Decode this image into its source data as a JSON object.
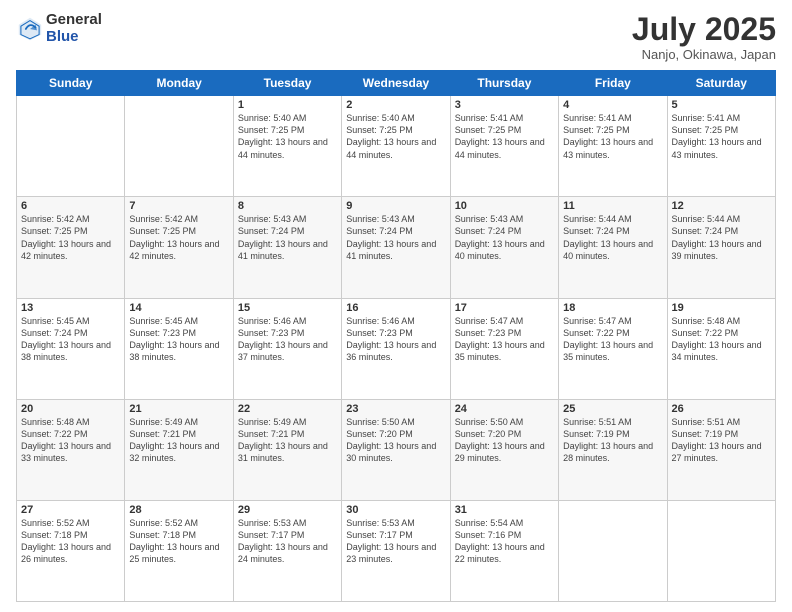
{
  "logo": {
    "general": "General",
    "blue": "Blue"
  },
  "header": {
    "month": "July 2025",
    "location": "Nanjo, Okinawa, Japan"
  },
  "weekdays": [
    "Sunday",
    "Monday",
    "Tuesday",
    "Wednesday",
    "Thursday",
    "Friday",
    "Saturday"
  ],
  "weeks": [
    [
      {
        "day": "",
        "info": ""
      },
      {
        "day": "",
        "info": ""
      },
      {
        "day": "1",
        "info": "Sunrise: 5:40 AM\nSunset: 7:25 PM\nDaylight: 13 hours and 44 minutes."
      },
      {
        "day": "2",
        "info": "Sunrise: 5:40 AM\nSunset: 7:25 PM\nDaylight: 13 hours and 44 minutes."
      },
      {
        "day": "3",
        "info": "Sunrise: 5:41 AM\nSunset: 7:25 PM\nDaylight: 13 hours and 44 minutes."
      },
      {
        "day": "4",
        "info": "Sunrise: 5:41 AM\nSunset: 7:25 PM\nDaylight: 13 hours and 43 minutes."
      },
      {
        "day": "5",
        "info": "Sunrise: 5:41 AM\nSunset: 7:25 PM\nDaylight: 13 hours and 43 minutes."
      }
    ],
    [
      {
        "day": "6",
        "info": "Sunrise: 5:42 AM\nSunset: 7:25 PM\nDaylight: 13 hours and 42 minutes."
      },
      {
        "day": "7",
        "info": "Sunrise: 5:42 AM\nSunset: 7:25 PM\nDaylight: 13 hours and 42 minutes."
      },
      {
        "day": "8",
        "info": "Sunrise: 5:43 AM\nSunset: 7:24 PM\nDaylight: 13 hours and 41 minutes."
      },
      {
        "day": "9",
        "info": "Sunrise: 5:43 AM\nSunset: 7:24 PM\nDaylight: 13 hours and 41 minutes."
      },
      {
        "day": "10",
        "info": "Sunrise: 5:43 AM\nSunset: 7:24 PM\nDaylight: 13 hours and 40 minutes."
      },
      {
        "day": "11",
        "info": "Sunrise: 5:44 AM\nSunset: 7:24 PM\nDaylight: 13 hours and 40 minutes."
      },
      {
        "day": "12",
        "info": "Sunrise: 5:44 AM\nSunset: 7:24 PM\nDaylight: 13 hours and 39 minutes."
      }
    ],
    [
      {
        "day": "13",
        "info": "Sunrise: 5:45 AM\nSunset: 7:24 PM\nDaylight: 13 hours and 38 minutes."
      },
      {
        "day": "14",
        "info": "Sunrise: 5:45 AM\nSunset: 7:23 PM\nDaylight: 13 hours and 38 minutes."
      },
      {
        "day": "15",
        "info": "Sunrise: 5:46 AM\nSunset: 7:23 PM\nDaylight: 13 hours and 37 minutes."
      },
      {
        "day": "16",
        "info": "Sunrise: 5:46 AM\nSunset: 7:23 PM\nDaylight: 13 hours and 36 minutes."
      },
      {
        "day": "17",
        "info": "Sunrise: 5:47 AM\nSunset: 7:23 PM\nDaylight: 13 hours and 35 minutes."
      },
      {
        "day": "18",
        "info": "Sunrise: 5:47 AM\nSunset: 7:22 PM\nDaylight: 13 hours and 35 minutes."
      },
      {
        "day": "19",
        "info": "Sunrise: 5:48 AM\nSunset: 7:22 PM\nDaylight: 13 hours and 34 minutes."
      }
    ],
    [
      {
        "day": "20",
        "info": "Sunrise: 5:48 AM\nSunset: 7:22 PM\nDaylight: 13 hours and 33 minutes."
      },
      {
        "day": "21",
        "info": "Sunrise: 5:49 AM\nSunset: 7:21 PM\nDaylight: 13 hours and 32 minutes."
      },
      {
        "day": "22",
        "info": "Sunrise: 5:49 AM\nSunset: 7:21 PM\nDaylight: 13 hours and 31 minutes."
      },
      {
        "day": "23",
        "info": "Sunrise: 5:50 AM\nSunset: 7:20 PM\nDaylight: 13 hours and 30 minutes."
      },
      {
        "day": "24",
        "info": "Sunrise: 5:50 AM\nSunset: 7:20 PM\nDaylight: 13 hours and 29 minutes."
      },
      {
        "day": "25",
        "info": "Sunrise: 5:51 AM\nSunset: 7:19 PM\nDaylight: 13 hours and 28 minutes."
      },
      {
        "day": "26",
        "info": "Sunrise: 5:51 AM\nSunset: 7:19 PM\nDaylight: 13 hours and 27 minutes."
      }
    ],
    [
      {
        "day": "27",
        "info": "Sunrise: 5:52 AM\nSunset: 7:18 PM\nDaylight: 13 hours and 26 minutes."
      },
      {
        "day": "28",
        "info": "Sunrise: 5:52 AM\nSunset: 7:18 PM\nDaylight: 13 hours and 25 minutes."
      },
      {
        "day": "29",
        "info": "Sunrise: 5:53 AM\nSunset: 7:17 PM\nDaylight: 13 hours and 24 minutes."
      },
      {
        "day": "30",
        "info": "Sunrise: 5:53 AM\nSunset: 7:17 PM\nDaylight: 13 hours and 23 minutes."
      },
      {
        "day": "31",
        "info": "Sunrise: 5:54 AM\nSunset: 7:16 PM\nDaylight: 13 hours and 22 minutes."
      },
      {
        "day": "",
        "info": ""
      },
      {
        "day": "",
        "info": ""
      }
    ]
  ]
}
